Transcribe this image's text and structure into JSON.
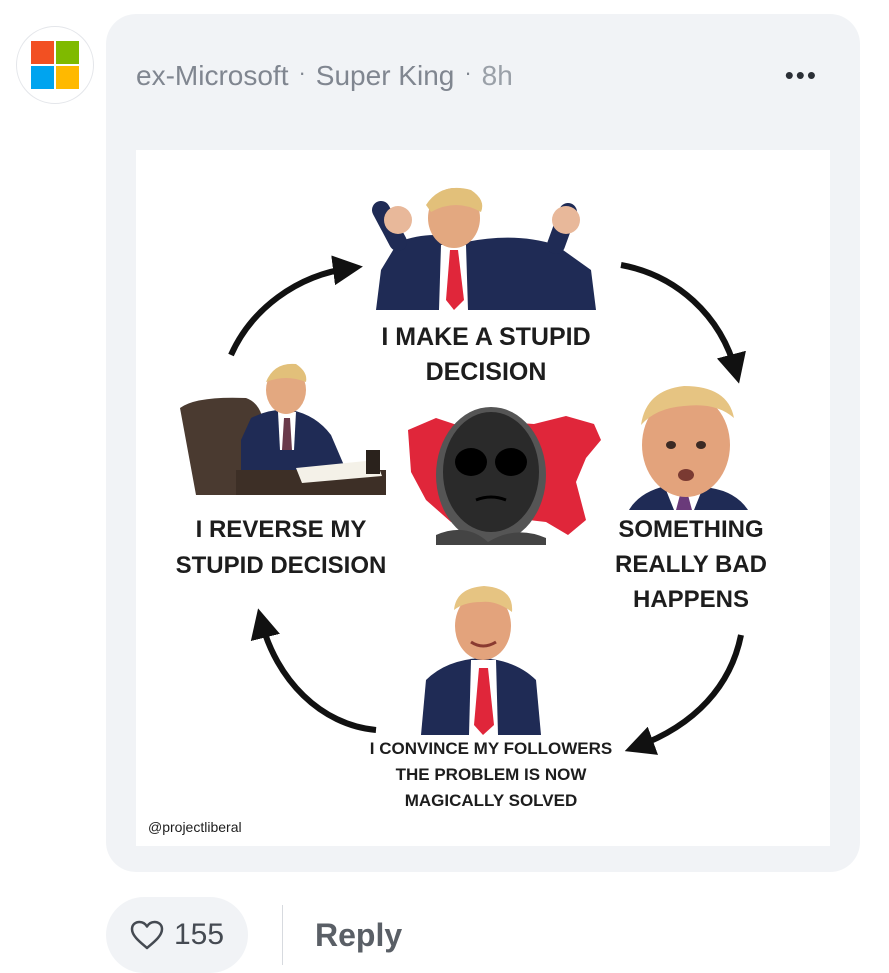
{
  "post": {
    "author_avatar_icon": "microsoft-logo-icon",
    "author_avatar_colors": [
      "#f25022",
      "#7fba00",
      "#00a4ef",
      "#ffb900"
    ],
    "company": "ex-Microsoft",
    "separator": "·",
    "username": "Super King",
    "time_ago": "8h",
    "more_icon": "more-horizontal-icon",
    "more_label": "•••"
  },
  "meme": {
    "captions": {
      "top": "I MAKE A STUPID\nDECISION",
      "right": "SOMETHING\nREALLY BAD\nHAPPENS",
      "bottom": "I CONVINCE MY FOLLOWERS\nTHE PROBLEM IS NOW\nMAGICALLY SOLVED",
      "left": "I REVERSE MY\nSTUPID DECISION"
    },
    "watermark": "@projectliberal",
    "accent_red": "#e0263a",
    "suit_navy": "#1f2b55"
  },
  "actions": {
    "like_icon": "heart-outline-icon",
    "like_count": "155",
    "reply_label": "Reply"
  }
}
